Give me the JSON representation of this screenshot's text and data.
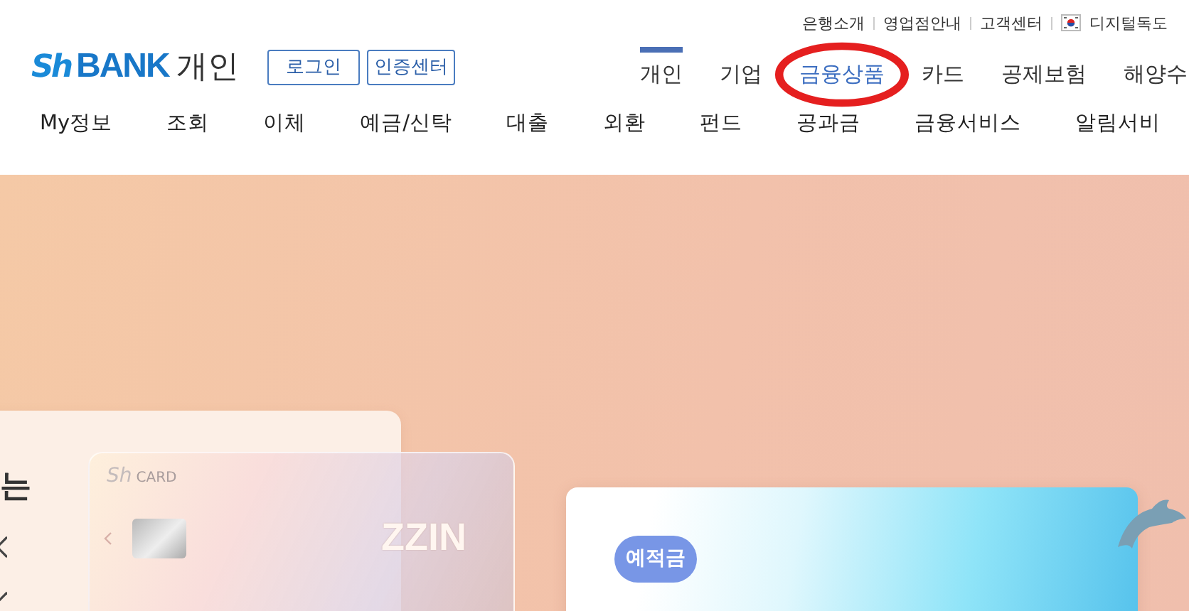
{
  "top_links": [
    {
      "label": "은행소개",
      "flag": false
    },
    {
      "label": "영업점안내",
      "flag": false
    },
    {
      "label": "고객센터",
      "flag": false
    },
    {
      "label": "디지털독도",
      "flag": true
    }
  ],
  "logo": {
    "mark": "Sh",
    "name": "BANK",
    "suffix": "개인"
  },
  "header_buttons": [
    "로그인",
    "인증센터"
  ],
  "main_nav": [
    {
      "label": "개인",
      "selected": true,
      "hovered": false,
      "circled": false
    },
    {
      "label": "기업",
      "selected": false,
      "hovered": false,
      "circled": false
    },
    {
      "label": "금융상품",
      "selected": false,
      "hovered": true,
      "circled": true
    },
    {
      "label": "카드",
      "selected": false,
      "hovered": false,
      "circled": false
    },
    {
      "label": "공제보험",
      "selected": false,
      "hovered": false,
      "circled": false
    },
    {
      "label": "해양수",
      "selected": false,
      "hovered": false,
      "circled": false
    }
  ],
  "sub_nav": [
    "My정보",
    "조회",
    "이체",
    "예금/신탁",
    "대출",
    "외환",
    "펀드",
    "공과금",
    "금융서비스",
    "알림서비"
  ],
  "banner": {
    "heading_fragment": "는",
    "card": {
      "brand": "Sh",
      "brand_suffix": "CARD",
      "name": "ZZIN"
    },
    "product_tag": "예적금"
  }
}
